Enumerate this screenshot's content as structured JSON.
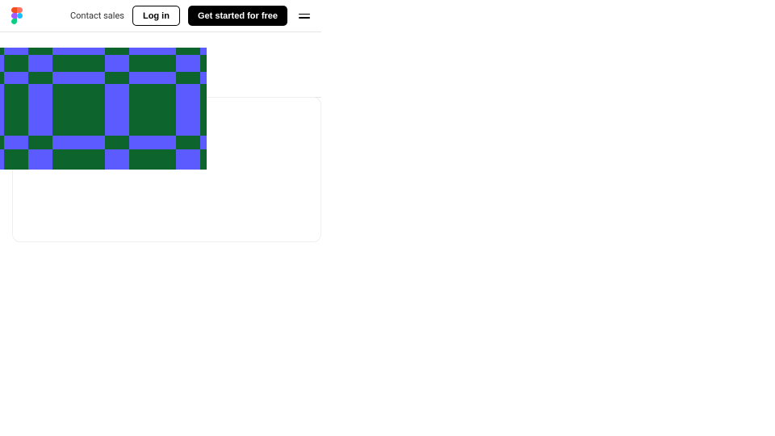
{
  "header": {
    "contact_label": "Contact sales",
    "login_label": "Log in",
    "cta_label": "Get started for free"
  },
  "pattern": {
    "green": "#0d652d",
    "blue": "#5b5bff"
  }
}
